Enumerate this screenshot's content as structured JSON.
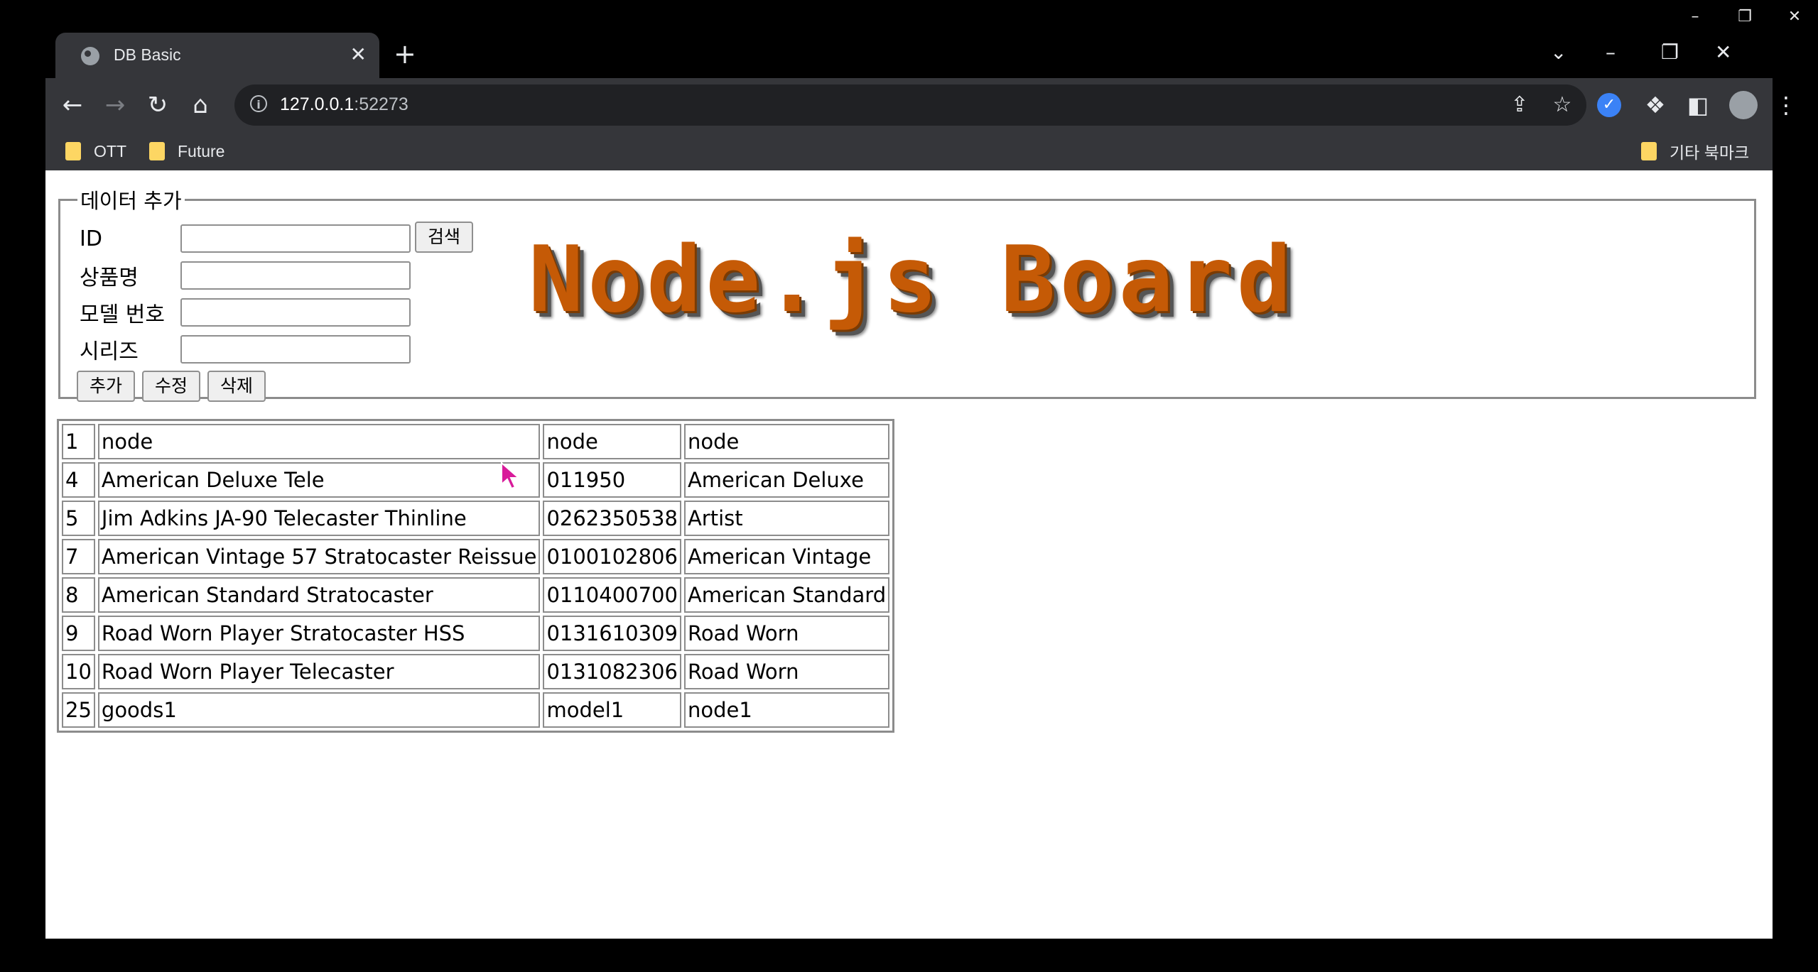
{
  "window": {
    "minimize_glyph": "–",
    "restore_glyph": "❐",
    "close_glyph": "✕"
  },
  "browser": {
    "tab_title": "DB Basic",
    "tab_close": "✕",
    "new_tab": "+",
    "tab_search": "⌄",
    "minimize": "–",
    "restore": "❐",
    "close": "✕",
    "nav": {
      "back": "←",
      "forward": "→",
      "reload": "↻",
      "home": "⌂"
    },
    "url_host": "127.0.0.1",
    "url_port": ":52273",
    "omnibox_icons": {
      "share": "⇪",
      "bookmark_star": "☆"
    },
    "extensions": {
      "ext1": "✓",
      "puzzle": "❖",
      "sidepanel": "◧",
      "menu": "⋮"
    },
    "bookmarks": [
      "OTT",
      "Future"
    ],
    "other_bookmarks": "기타 북마크"
  },
  "form": {
    "legend": "데이터 추가",
    "fields": [
      {
        "label": "ID",
        "value": ""
      },
      {
        "label": "상품명",
        "value": ""
      },
      {
        "label": "모델 번호",
        "value": ""
      },
      {
        "label": "시리즈",
        "value": ""
      }
    ],
    "search_button": "검색",
    "add_button": "추가",
    "edit_button": "수정",
    "delete_button": "삭제"
  },
  "board_title": "Node.js Board",
  "table": {
    "rows": [
      [
        "1",
        "node",
        "node",
        "node"
      ],
      [
        "4",
        "American Deluxe Tele",
        "011950",
        "American Deluxe"
      ],
      [
        "5",
        "Jim Adkins JA-90 Telecaster Thinline",
        "0262350538",
        "Artist"
      ],
      [
        "7",
        "American Vintage 57 Stratocaster Reissue",
        "0100102806",
        "American Vintage"
      ],
      [
        "8",
        "American Standard Stratocaster",
        "0110400700",
        "American Standard"
      ],
      [
        "9",
        "Road Worn Player Stratocaster HSS",
        "0131610309",
        "Road Worn"
      ],
      [
        "10",
        "Road Worn Player Telecaster",
        "0131082306",
        "Road Worn"
      ],
      [
        "25",
        "goods1",
        "model1",
        "node1"
      ]
    ]
  }
}
